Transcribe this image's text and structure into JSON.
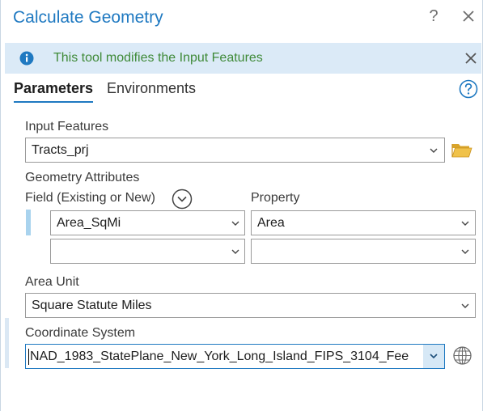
{
  "window": {
    "title": "Calculate Geometry",
    "help_glyph": "?",
    "close_icon": "close-icon"
  },
  "banner": {
    "icon": "info-icon",
    "message": "This tool modifies the Input Features",
    "dismiss_icon": "close-icon"
  },
  "tabs": [
    {
      "label": "Parameters",
      "active": true
    },
    {
      "label": "Environments",
      "active": false
    }
  ],
  "form": {
    "input_features": {
      "label": "Input Features",
      "value": "Tracts_prj"
    },
    "geometry_attributes": {
      "label": "Geometry Attributes",
      "field_header": "Field (Existing or New)",
      "property_header": "Property",
      "rows": [
        {
          "field": "Area_SqMi",
          "property": "Area"
        },
        {
          "field": "",
          "property": ""
        }
      ]
    },
    "area_unit": {
      "label": "Area Unit",
      "value": "Square Statute Miles"
    },
    "coordinate_system": {
      "label": "Coordinate System",
      "value": "NAD_1983_StatePlane_New_York_Long_Island_FIPS_3104_Fee"
    }
  },
  "colors": {
    "accent": "#1f79c1",
    "banner_bg": "#dbeaf7",
    "banner_text": "#3f8a38",
    "folder": "#e8b73a"
  }
}
